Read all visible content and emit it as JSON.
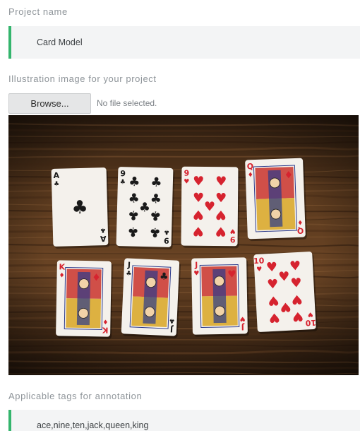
{
  "project_name": {
    "label": "Project name",
    "value": "Card Model"
  },
  "illustration": {
    "label": "Illustration image for your project",
    "browse_label": "Browse...",
    "file_status": "No file selected."
  },
  "preview": {
    "cards": [
      {
        "rank": "A",
        "suit": "clubs"
      },
      {
        "rank": "9",
        "suit": "clubs"
      },
      {
        "rank": "9",
        "suit": "hearts"
      },
      {
        "rank": "Q",
        "suit": "diamonds"
      },
      {
        "rank": "K",
        "suit": "diamonds"
      },
      {
        "rank": "J",
        "suit": "clubs"
      },
      {
        "rank": "J",
        "suit": "hearts"
      },
      {
        "rank": "10",
        "suit": "hearts"
      }
    ]
  },
  "tags": {
    "label": "Applicable tags for annotation",
    "value": "ace,nine,ten,jack,queen,king"
  },
  "colors": {
    "accent": "#34b56d",
    "field_bg": "#f3f4f5",
    "label": "#8e9499",
    "red_suit": "#d6232f",
    "black_suit": "#1a1a1a"
  }
}
